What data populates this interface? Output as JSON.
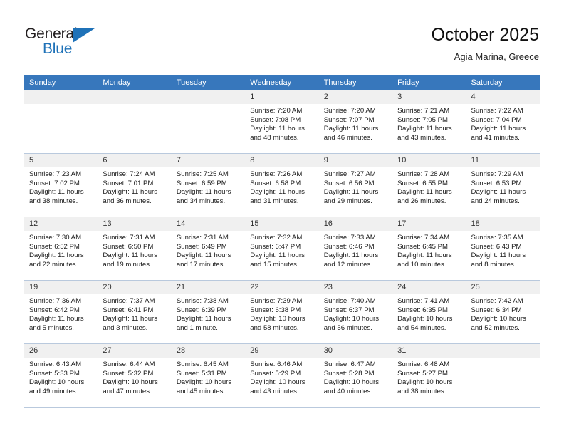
{
  "brand": {
    "name_top": "General",
    "name_bottom": "Blue"
  },
  "header": {
    "title": "October 2025",
    "subtitle": "Agia Marina, Greece"
  },
  "colors": {
    "header_blue": "#3777bc",
    "brand_blue": "#1f72b8",
    "daynum_bg": "#f0f0f0",
    "grid_line": "#b9c9dd"
  },
  "weekdays": [
    "Sunday",
    "Monday",
    "Tuesday",
    "Wednesday",
    "Thursday",
    "Friday",
    "Saturday"
  ],
  "weeks": [
    [
      {
        "day": "",
        "sunrise": "",
        "sunset": "",
        "daylight": ""
      },
      {
        "day": "",
        "sunrise": "",
        "sunset": "",
        "daylight": ""
      },
      {
        "day": "",
        "sunrise": "",
        "sunset": "",
        "daylight": ""
      },
      {
        "day": "1",
        "sunrise": "Sunrise: 7:20 AM",
        "sunset": "Sunset: 7:08 PM",
        "daylight": "Daylight: 11 hours and 48 minutes."
      },
      {
        "day": "2",
        "sunrise": "Sunrise: 7:20 AM",
        "sunset": "Sunset: 7:07 PM",
        "daylight": "Daylight: 11 hours and 46 minutes."
      },
      {
        "day": "3",
        "sunrise": "Sunrise: 7:21 AM",
        "sunset": "Sunset: 7:05 PM",
        "daylight": "Daylight: 11 hours and 43 minutes."
      },
      {
        "day": "4",
        "sunrise": "Sunrise: 7:22 AM",
        "sunset": "Sunset: 7:04 PM",
        "daylight": "Daylight: 11 hours and 41 minutes."
      }
    ],
    [
      {
        "day": "5",
        "sunrise": "Sunrise: 7:23 AM",
        "sunset": "Sunset: 7:02 PM",
        "daylight": "Daylight: 11 hours and 38 minutes."
      },
      {
        "day": "6",
        "sunrise": "Sunrise: 7:24 AM",
        "sunset": "Sunset: 7:01 PM",
        "daylight": "Daylight: 11 hours and 36 minutes."
      },
      {
        "day": "7",
        "sunrise": "Sunrise: 7:25 AM",
        "sunset": "Sunset: 6:59 PM",
        "daylight": "Daylight: 11 hours and 34 minutes."
      },
      {
        "day": "8",
        "sunrise": "Sunrise: 7:26 AM",
        "sunset": "Sunset: 6:58 PM",
        "daylight": "Daylight: 11 hours and 31 minutes."
      },
      {
        "day": "9",
        "sunrise": "Sunrise: 7:27 AM",
        "sunset": "Sunset: 6:56 PM",
        "daylight": "Daylight: 11 hours and 29 minutes."
      },
      {
        "day": "10",
        "sunrise": "Sunrise: 7:28 AM",
        "sunset": "Sunset: 6:55 PM",
        "daylight": "Daylight: 11 hours and 26 minutes."
      },
      {
        "day": "11",
        "sunrise": "Sunrise: 7:29 AM",
        "sunset": "Sunset: 6:53 PM",
        "daylight": "Daylight: 11 hours and 24 minutes."
      }
    ],
    [
      {
        "day": "12",
        "sunrise": "Sunrise: 7:30 AM",
        "sunset": "Sunset: 6:52 PM",
        "daylight": "Daylight: 11 hours and 22 minutes."
      },
      {
        "day": "13",
        "sunrise": "Sunrise: 7:31 AM",
        "sunset": "Sunset: 6:50 PM",
        "daylight": "Daylight: 11 hours and 19 minutes."
      },
      {
        "day": "14",
        "sunrise": "Sunrise: 7:31 AM",
        "sunset": "Sunset: 6:49 PM",
        "daylight": "Daylight: 11 hours and 17 minutes."
      },
      {
        "day": "15",
        "sunrise": "Sunrise: 7:32 AM",
        "sunset": "Sunset: 6:47 PM",
        "daylight": "Daylight: 11 hours and 15 minutes."
      },
      {
        "day": "16",
        "sunrise": "Sunrise: 7:33 AM",
        "sunset": "Sunset: 6:46 PM",
        "daylight": "Daylight: 11 hours and 12 minutes."
      },
      {
        "day": "17",
        "sunrise": "Sunrise: 7:34 AM",
        "sunset": "Sunset: 6:45 PM",
        "daylight": "Daylight: 11 hours and 10 minutes."
      },
      {
        "day": "18",
        "sunrise": "Sunrise: 7:35 AM",
        "sunset": "Sunset: 6:43 PM",
        "daylight": "Daylight: 11 hours and 8 minutes."
      }
    ],
    [
      {
        "day": "19",
        "sunrise": "Sunrise: 7:36 AM",
        "sunset": "Sunset: 6:42 PM",
        "daylight": "Daylight: 11 hours and 5 minutes."
      },
      {
        "day": "20",
        "sunrise": "Sunrise: 7:37 AM",
        "sunset": "Sunset: 6:41 PM",
        "daylight": "Daylight: 11 hours and 3 minutes."
      },
      {
        "day": "21",
        "sunrise": "Sunrise: 7:38 AM",
        "sunset": "Sunset: 6:39 PM",
        "daylight": "Daylight: 11 hours and 1 minute."
      },
      {
        "day": "22",
        "sunrise": "Sunrise: 7:39 AM",
        "sunset": "Sunset: 6:38 PM",
        "daylight": "Daylight: 10 hours and 58 minutes."
      },
      {
        "day": "23",
        "sunrise": "Sunrise: 7:40 AM",
        "sunset": "Sunset: 6:37 PM",
        "daylight": "Daylight: 10 hours and 56 minutes."
      },
      {
        "day": "24",
        "sunrise": "Sunrise: 7:41 AM",
        "sunset": "Sunset: 6:35 PM",
        "daylight": "Daylight: 10 hours and 54 minutes."
      },
      {
        "day": "25",
        "sunrise": "Sunrise: 7:42 AM",
        "sunset": "Sunset: 6:34 PM",
        "daylight": "Daylight: 10 hours and 52 minutes."
      }
    ],
    [
      {
        "day": "26",
        "sunrise": "Sunrise: 6:43 AM",
        "sunset": "Sunset: 5:33 PM",
        "daylight": "Daylight: 10 hours and 49 minutes."
      },
      {
        "day": "27",
        "sunrise": "Sunrise: 6:44 AM",
        "sunset": "Sunset: 5:32 PM",
        "daylight": "Daylight: 10 hours and 47 minutes."
      },
      {
        "day": "28",
        "sunrise": "Sunrise: 6:45 AM",
        "sunset": "Sunset: 5:31 PM",
        "daylight": "Daylight: 10 hours and 45 minutes."
      },
      {
        "day": "29",
        "sunrise": "Sunrise: 6:46 AM",
        "sunset": "Sunset: 5:29 PM",
        "daylight": "Daylight: 10 hours and 43 minutes."
      },
      {
        "day": "30",
        "sunrise": "Sunrise: 6:47 AM",
        "sunset": "Sunset: 5:28 PM",
        "daylight": "Daylight: 10 hours and 40 minutes."
      },
      {
        "day": "31",
        "sunrise": "Sunrise: 6:48 AM",
        "sunset": "Sunset: 5:27 PM",
        "daylight": "Daylight: 10 hours and 38 minutes."
      },
      {
        "day": "",
        "sunrise": "",
        "sunset": "",
        "daylight": ""
      }
    ]
  ]
}
